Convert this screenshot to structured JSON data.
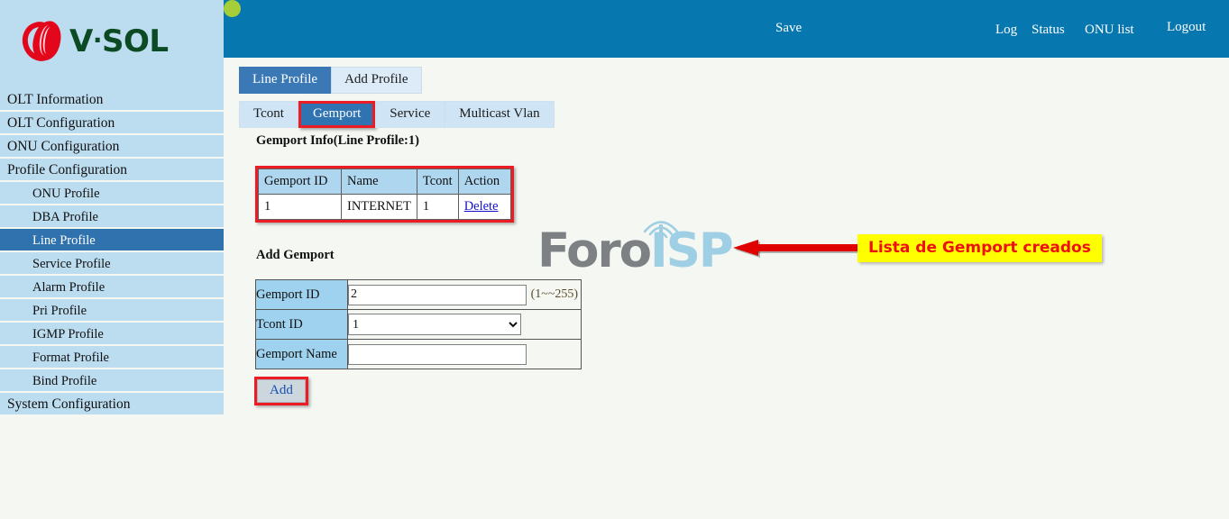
{
  "brand": {
    "name": "V·SOL",
    "logo_icon": "vsol-flame-logo",
    "text_part1": "V",
    "separator": "·",
    "text_part2": "SOL"
  },
  "topbar": {
    "save_label": "Save",
    "status_led": "green-status-led",
    "led_color": "#a6ce39",
    "log_label": "Log",
    "status_label": "Status",
    "onu_list_label": "ONU list",
    "logout_label": "Logout",
    "background_color": "#0777b0"
  },
  "sidebar": {
    "items": [
      {
        "label": "OLT Information",
        "level": 0,
        "active": false
      },
      {
        "label": "OLT Configuration",
        "level": 0,
        "active": false
      },
      {
        "label": "ONU Configuration",
        "level": 0,
        "active": false
      },
      {
        "label": "Profile Configuration",
        "level": 0,
        "active": false
      },
      {
        "label": "ONU Profile",
        "level": 1,
        "active": false
      },
      {
        "label": "DBA Profile",
        "level": 1,
        "active": false
      },
      {
        "label": "Line Profile",
        "level": 1,
        "active": true
      },
      {
        "label": "Service Profile",
        "level": 1,
        "active": false
      },
      {
        "label": "Alarm Profile",
        "level": 1,
        "active": false
      },
      {
        "label": "Pri Profile",
        "level": 1,
        "active": false
      },
      {
        "label": "IGMP Profile",
        "level": 1,
        "active": false
      },
      {
        "label": "Format Profile",
        "level": 1,
        "active": false
      },
      {
        "label": "Bind Profile",
        "level": 1,
        "active": false
      },
      {
        "label": "System Configuration",
        "level": 0,
        "active": false
      }
    ],
    "active_color": "#3072ae",
    "item_color": "#bcdcf0"
  },
  "main": {
    "primary_tabs": [
      {
        "label": "Line Profile",
        "active": true
      },
      {
        "label": "Add Profile",
        "active": false
      }
    ],
    "secondary_tabs": [
      {
        "label": "Tcont",
        "active": false,
        "highlighted": false
      },
      {
        "label": "Gemport",
        "active": true,
        "highlighted": true
      },
      {
        "label": "Service",
        "active": false,
        "highlighted": false
      },
      {
        "label": "Multicast Vlan",
        "active": false,
        "highlighted": false
      }
    ],
    "info_section": {
      "heading": "Gemport Info(Line Profile:1)",
      "columns": [
        "Gemport ID",
        "Name",
        "Tcont",
        "Action"
      ],
      "rows": [
        {
          "gemport_id": "1",
          "name": "INTERNET",
          "tcont": "1",
          "action": "Delete"
        }
      ],
      "highlight_color": "#ed1c24"
    },
    "annotation": {
      "text": "Lista de Gemport creados",
      "background_color": "#ffff00",
      "text_color": "#ee1111",
      "arrow_color": "#e00000",
      "arrow_icon": "left-arrow-annotation"
    },
    "add_section": {
      "heading": "Add Gemport",
      "fields": [
        {
          "label": "Gemport ID",
          "type": "text",
          "value": "2",
          "placeholder": "",
          "hint": "(1~~255)"
        },
        {
          "label": "Tcont ID",
          "type": "select",
          "value": "1",
          "options": [
            "1"
          ],
          "hint": ""
        },
        {
          "label": "Gemport Name",
          "type": "text",
          "value": "",
          "placeholder": "",
          "hint": ""
        }
      ],
      "submit_label": "Add",
      "submit_highlight_color": "#ed1c24"
    }
  },
  "watermark": {
    "part1": "Foro",
    "part2": "ISP",
    "icon": "broadcast-tower-icon",
    "color1": "#7d8183",
    "color2": "#9ecfe5"
  }
}
